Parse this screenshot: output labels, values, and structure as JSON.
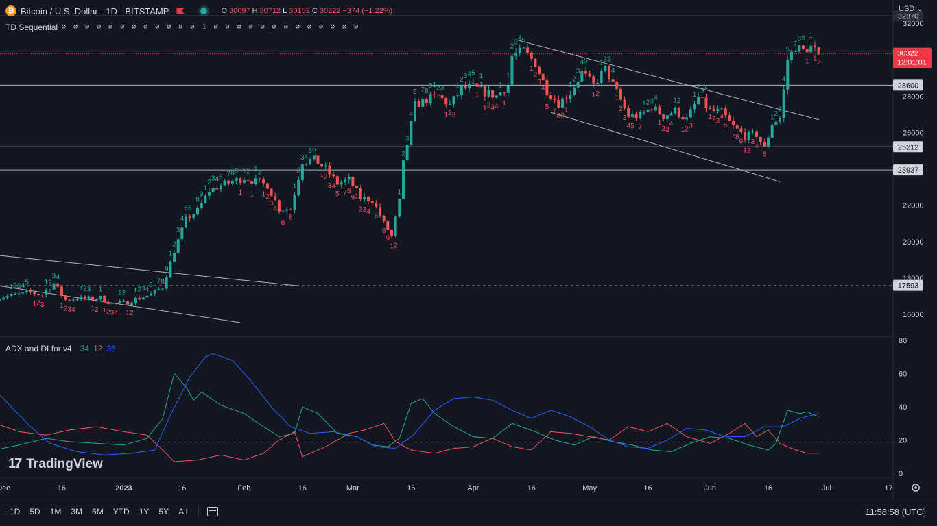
{
  "header": {
    "symbol_logo": "₿",
    "title": "Bitcoin / U.S. Dollar · 1D · BITSTAMP",
    "ohlc": {
      "o_label": "O",
      "o": "30697",
      "h_label": "H",
      "h": "30712",
      "l_label": "L",
      "l": "30152",
      "c_label": "C",
      "c": "30322",
      "change": "−374 (−1.22%)"
    }
  },
  "td_sequential": {
    "label": "TD Sequential",
    "values_a": "∅ ∅ ∅ ∅ ∅ ∅ ∅ ∅ ∅ ∅ ∅ ∅",
    "value_red": "1",
    "values_b": "∅ ∅ ∅ ∅ ∅ ∅ ∅ ∅ ∅ ∅ ∅ ∅ ∅"
  },
  "adx_indicator": {
    "label": "ADX and DI for v4",
    "plus_di": "34",
    "minus_di": "12",
    "adx": "36"
  },
  "currency": "USD ⌄",
  "branding": {
    "logo": "TradingView",
    "logo_mark": "17"
  },
  "toolbar": {
    "timeframes": [
      "1D",
      "5D",
      "1M",
      "3M",
      "6M",
      "YTD",
      "1Y",
      "5Y",
      "All"
    ],
    "clock": "11:58:58 (UTC)"
  },
  "colors": {
    "background": "#131722",
    "up": "#26a69a",
    "down": "#ef5350",
    "plus_di": "#22ab94",
    "minus_di": "#f7525f",
    "adx": "#2962ff",
    "text": "#d1d4dc",
    "price_badge": "#f23645"
  },
  "chart_data": [
    {
      "type": "candlestick",
      "price_axis_ticks": [
        "32000",
        "28000",
        "26000",
        "22000",
        "20000",
        "18000",
        "16000"
      ],
      "ylim": [
        15000,
        32500
      ],
      "x_ticks": [
        "Dec",
        "16",
        "2023",
        "16",
        "Feb",
        "16",
        "Mar",
        "16",
        "Apr",
        "16",
        "May",
        "16",
        "Jun",
        "16",
        "Jul",
        "17"
      ],
      "x_tick_dates": [
        "2022-12-01",
        "2022-12-16",
        "2023-01-01",
        "2023-01-16",
        "2023-02-01",
        "2023-02-16",
        "2023-03-01",
        "2023-03-16",
        "2023-04-01",
        "2023-04-16",
        "2023-05-01",
        "2023-05-16",
        "2023-06-01",
        "2023-06-16",
        "2023-07-01",
        "2023-07-17"
      ],
      "horizontal_levels": [
        {
          "price": 32400,
          "label": "32370"
        },
        {
          "price": 28600,
          "label": "28600"
        },
        {
          "price": 25212,
          "label": "25212"
        },
        {
          "price": 23937,
          "label": "23937"
        },
        {
          "price": 17593,
          "label": "17593",
          "dashed": true
        }
      ],
      "current_price": {
        "price": 30322,
        "label": "30322",
        "countdown": "12:01:01"
      },
      "trendlines": [
        {
          "start": [
            "2022-11-29",
            17600
          ],
          "end": [
            "2023-01-31",
            15550
          ]
        },
        {
          "start": [
            "2022-11-27",
            19300
          ],
          "end": [
            "2023-02-16",
            17550
          ]
        },
        {
          "start": [
            "2023-04-12",
            31100
          ],
          "end": [
            "2023-06-29",
            26700
          ]
        },
        {
          "start": [
            "2023-04-21",
            27100
          ],
          "end": [
            "2023-06-19",
            23290
          ]
        }
      ],
      "close_path": [
        [
          "2022-11-29",
          16900
        ],
        [
          "2022-12-02",
          17000
        ],
        [
          "2022-12-05",
          17100
        ],
        [
          "2022-12-08",
          17200
        ],
        [
          "2022-12-11",
          17100
        ],
        [
          "2022-12-14",
          17700
        ],
        [
          "2022-12-17",
          16800
        ],
        [
          "2022-12-20",
          16900
        ],
        [
          "2022-12-23",
          16850
        ],
        [
          "2022-12-26",
          16900
        ],
        [
          "2022-12-29",
          16600
        ],
        [
          "2023-01-01",
          16600
        ],
        [
          "2023-01-05",
          16900
        ],
        [
          "2023-01-08",
          17100
        ],
        [
          "2023-01-11",
          17500
        ],
        [
          "2023-01-14",
          19500
        ],
        [
          "2023-01-17",
          21200
        ],
        [
          "2023-01-20",
          21700
        ],
        [
          "2023-01-23",
          22800
        ],
        [
          "2023-01-26",
          23100
        ],
        [
          "2023-01-29",
          23300
        ],
        [
          "2023-02-01",
          23500
        ],
        [
          "2023-02-04",
          23300
        ],
        [
          "2023-02-07",
          23100
        ],
        [
          "2023-02-10",
          21800
        ],
        [
          "2023-02-13",
          21800
        ],
        [
          "2023-02-16",
          24400
        ],
        [
          "2023-02-19",
          24500
        ],
        [
          "2023-02-22",
          24000
        ],
        [
          "2023-02-25",
          23200
        ],
        [
          "2023-02-28",
          23400
        ],
        [
          "2023-03-03",
          22400
        ],
        [
          "2023-03-06",
          22300
        ],
        [
          "2023-03-09",
          21000
        ],
        [
          "2023-03-11",
          20300
        ],
        [
          "2023-03-13",
          22200
        ],
        [
          "2023-03-14",
          24300
        ],
        [
          "2023-03-17",
          27500
        ],
        [
          "2023-03-20",
          27800
        ],
        [
          "2023-03-23",
          28000
        ],
        [
          "2023-03-26",
          27500
        ],
        [
          "2023-03-29",
          28400
        ],
        [
          "2023-04-01",
          28500
        ],
        [
          "2023-04-04",
          28200
        ],
        [
          "2023-04-07",
          28000
        ],
        [
          "2023-04-10",
          28600
        ],
        [
          "2023-04-11",
          30200
        ],
        [
          "2023-04-14",
          30500
        ],
        [
          "2023-04-17",
          29800
        ],
        [
          "2023-04-20",
          28300
        ],
        [
          "2023-04-23",
          27600
        ],
        [
          "2023-04-26",
          28200
        ],
        [
          "2023-04-29",
          29300
        ],
        [
          "2023-05-02",
          28600
        ],
        [
          "2023-05-05",
          29500
        ],
        [
          "2023-05-08",
          28200
        ],
        [
          "2023-05-11",
          26900
        ],
        [
          "2023-05-14",
          26900
        ],
        [
          "2023-05-17",
          27400
        ],
        [
          "2023-05-20",
          26900
        ],
        [
          "2023-05-23",
          27200
        ],
        [
          "2023-05-26",
          26700
        ],
        [
          "2023-05-29",
          27900
        ],
        [
          "2023-06-01",
          27200
        ],
        [
          "2023-06-04",
          27100
        ],
        [
          "2023-06-07",
          26300
        ],
        [
          "2023-06-10",
          25800
        ],
        [
          "2023-06-13",
          25900
        ],
        [
          "2023-06-15",
          25100
        ],
        [
          "2023-06-17",
          26500
        ],
        [
          "2023-06-19",
          26800
        ],
        [
          "2023-06-20",
          28300
        ],
        [
          "2023-06-21",
          30000
        ],
        [
          "2023-06-23",
          30700
        ],
        [
          "2023-06-25",
          30500
        ],
        [
          "2023-06-27",
          30700
        ],
        [
          "2023-06-29",
          30322
        ]
      ]
    },
    {
      "type": "line",
      "y_axis_ticks": [
        "80",
        "60",
        "40",
        "20",
        "0"
      ],
      "ylim": [
        0,
        80
      ],
      "reference_line": 20,
      "series": [
        {
          "name": "34",
          "color": "#22ab94",
          "points": [
            [
              "2022-11-29",
              14
            ],
            [
              "2022-12-05",
              17
            ],
            [
              "2022-12-12",
              21
            ],
            [
              "2022-12-18",
              19
            ],
            [
              "2022-12-25",
              18
            ],
            [
              "2023-01-01",
              17
            ],
            [
              "2023-01-07",
              21
            ],
            [
              "2023-01-11",
              33
            ],
            [
              "2023-01-14",
              60
            ],
            [
              "2023-01-17",
              52
            ],
            [
              "2023-01-19",
              44
            ],
            [
              "2023-01-21",
              49
            ],
            [
              "2023-01-26",
              41
            ],
            [
              "2023-02-01",
              36
            ],
            [
              "2023-02-06",
              28
            ],
            [
              "2023-02-10",
              22
            ],
            [
              "2023-02-14",
              24
            ],
            [
              "2023-02-16",
              40
            ],
            [
              "2023-02-20",
              36
            ],
            [
              "2023-02-25",
              24
            ],
            [
              "2023-03-02",
              22
            ],
            [
              "2023-03-06",
              17
            ],
            [
              "2023-03-10",
              16
            ],
            [
              "2023-03-13",
              21
            ],
            [
              "2023-03-16",
              42
            ],
            [
              "2023-03-19",
              45
            ],
            [
              "2023-03-22",
              36
            ],
            [
              "2023-03-27",
              28
            ],
            [
              "2023-04-01",
              22
            ],
            [
              "2023-04-06",
              21
            ],
            [
              "2023-04-11",
              30
            ],
            [
              "2023-04-17",
              25
            ],
            [
              "2023-04-22",
              20
            ],
            [
              "2023-04-27",
              17
            ],
            [
              "2023-05-02",
              22
            ],
            [
              "2023-05-07",
              19
            ],
            [
              "2023-05-12",
              17
            ],
            [
              "2023-05-17",
              14
            ],
            [
              "2023-05-22",
              13
            ],
            [
              "2023-05-27",
              18
            ],
            [
              "2023-06-01",
              22
            ],
            [
              "2023-06-06",
              21
            ],
            [
              "2023-06-11",
              17
            ],
            [
              "2023-06-16",
              14
            ],
            [
              "2023-06-18",
              18
            ],
            [
              "2023-06-21",
              38
            ],
            [
              "2023-06-24",
              36
            ],
            [
              "2023-06-26",
              37
            ],
            [
              "2023-06-29",
              34
            ]
          ]
        },
        {
          "name": "12",
          "color": "#f7525f",
          "points": [
            [
              "2022-11-29",
              30
            ],
            [
              "2022-12-05",
              25
            ],
            [
              "2022-12-12",
              23
            ],
            [
              "2022-12-18",
              26
            ],
            [
              "2022-12-25",
              28
            ],
            [
              "2023-01-01",
              25
            ],
            [
              "2023-01-07",
              23
            ],
            [
              "2023-01-11",
              14
            ],
            [
              "2023-01-14",
              7
            ],
            [
              "2023-01-20",
              8
            ],
            [
              "2023-01-26",
              11
            ],
            [
              "2023-02-01",
              8
            ],
            [
              "2023-02-06",
              12
            ],
            [
              "2023-02-10",
              20
            ],
            [
              "2023-02-14",
              25
            ],
            [
              "2023-02-16",
              10
            ],
            [
              "2023-02-22",
              16
            ],
            [
              "2023-02-28",
              24
            ],
            [
              "2023-03-04",
              26
            ],
            [
              "2023-03-09",
              30
            ],
            [
              "2023-03-12",
              19
            ],
            [
              "2023-03-16",
              14
            ],
            [
              "2023-03-22",
              12
            ],
            [
              "2023-03-27",
              15
            ],
            [
              "2023-04-01",
              16
            ],
            [
              "2023-04-06",
              21
            ],
            [
              "2023-04-11",
              16
            ],
            [
              "2023-04-16",
              14
            ],
            [
              "2023-04-21",
              25
            ],
            [
              "2023-04-26",
              24
            ],
            [
              "2023-05-01",
              22
            ],
            [
              "2023-05-06",
              20
            ],
            [
              "2023-05-11",
              28
            ],
            [
              "2023-05-16",
              25
            ],
            [
              "2023-05-21",
              30
            ],
            [
              "2023-05-26",
              22
            ],
            [
              "2023-06-01",
              18
            ],
            [
              "2023-06-06",
              24
            ],
            [
              "2023-06-10",
              30
            ],
            [
              "2023-06-13",
              22
            ],
            [
              "2023-06-16",
              26
            ],
            [
              "2023-06-19",
              18
            ],
            [
              "2023-06-22",
              15
            ],
            [
              "2023-06-26",
              12
            ],
            [
              "2023-06-29",
              12
            ]
          ]
        },
        {
          "name": "36",
          "color": "#2962ff",
          "points": [
            [
              "2022-11-29",
              50
            ],
            [
              "2022-12-03",
              40
            ],
            [
              "2022-12-08",
              28
            ],
            [
              "2022-12-13",
              18
            ],
            [
              "2022-12-20",
              13
            ],
            [
              "2022-12-27",
              11
            ],
            [
              "2023-01-03",
              12
            ],
            [
              "2023-01-09",
              14
            ],
            [
              "2023-01-13",
              35
            ],
            [
              "2023-01-18",
              58
            ],
            [
              "2023-01-22",
              70
            ],
            [
              "2023-01-24",
              72
            ],
            [
              "2023-01-29",
              68
            ],
            [
              "2023-02-03",
              55
            ],
            [
              "2023-02-08",
              40
            ],
            [
              "2023-02-13",
              28
            ],
            [
              "2023-02-18",
              24
            ],
            [
              "2023-02-24",
              25
            ],
            [
              "2023-03-02",
              22
            ],
            [
              "2023-03-07",
              16
            ],
            [
              "2023-03-12",
              15
            ],
            [
              "2023-03-17",
              24
            ],
            [
              "2023-03-22",
              38
            ],
            [
              "2023-03-27",
              45
            ],
            [
              "2023-04-01",
              46
            ],
            [
              "2023-04-06",
              44
            ],
            [
              "2023-04-11",
              38
            ],
            [
              "2023-04-16",
              33
            ],
            [
              "2023-04-21",
              38
            ],
            [
              "2023-04-26",
              34
            ],
            [
              "2023-05-01",
              28
            ],
            [
              "2023-05-06",
              20
            ],
            [
              "2023-05-11",
              16
            ],
            [
              "2023-05-16",
              15
            ],
            [
              "2023-05-21",
              20
            ],
            [
              "2023-05-26",
              27
            ],
            [
              "2023-05-31",
              26
            ],
            [
              "2023-06-05",
              22
            ],
            [
              "2023-06-10",
              22
            ],
            [
              "2023-06-15",
              28
            ],
            [
              "2023-06-20",
              28
            ],
            [
              "2023-06-24",
              33
            ],
            [
              "2023-06-29",
              36
            ]
          ]
        }
      ]
    }
  ]
}
